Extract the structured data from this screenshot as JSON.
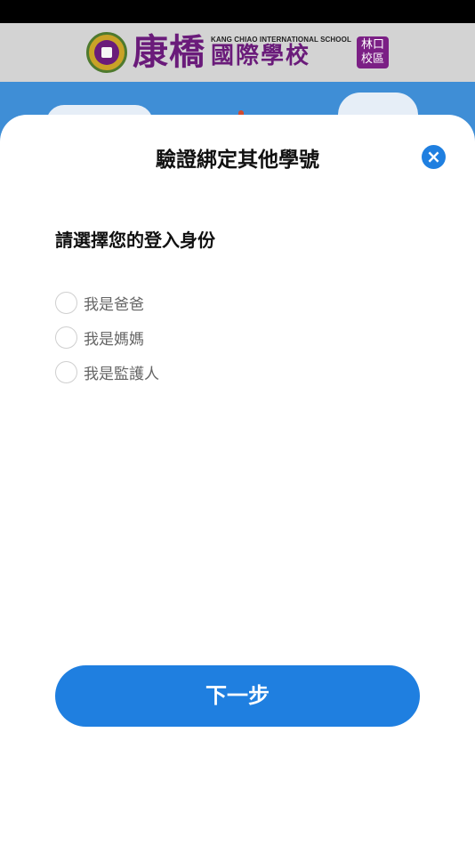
{
  "header": {
    "school_name_main": "康橋",
    "school_name_english": "KANG CHIAO INTERNATIONAL SCHOOL",
    "school_name_sub": "國際學校",
    "campus_line1": "林口",
    "campus_line2": "校區"
  },
  "dialog": {
    "title": "驗證綁定其他學號",
    "close_icon": "×",
    "prompt": "請選擇您的登入身份",
    "options": [
      {
        "label": "我是爸爸",
        "selected": false
      },
      {
        "label": "我是媽媽",
        "selected": false
      },
      {
        "label": "我是監護人",
        "selected": false
      }
    ],
    "next_button": "下一步"
  },
  "colors": {
    "accent": "#1f7fe0",
    "brand_purple": "#6a1b7a",
    "sky_blue": "#3f8ed6"
  }
}
